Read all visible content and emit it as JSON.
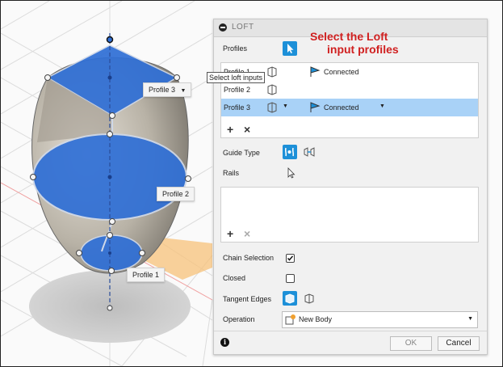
{
  "panel": {
    "title": "LOFT",
    "profiles_label": "Profiles",
    "profile_rows": [
      {
        "name": "Profile 1",
        "connection": "Connected",
        "selected": false
      },
      {
        "name": "Profile 2",
        "connection": "",
        "selected": false
      },
      {
        "name": "Profile 3",
        "connection": "Connected",
        "selected": true
      }
    ],
    "tooltip": "Select loft inputs",
    "guide_type_label": "Guide Type",
    "rails_label": "Rails",
    "chain_selection_label": "Chain Selection",
    "chain_selection_checked": true,
    "closed_label": "Closed",
    "closed_checked": false,
    "tangent_edges_label": "Tangent Edges",
    "operation_label": "Operation",
    "operation_value": "New Body",
    "ok_label": "OK",
    "cancel_label": "Cancel",
    "add_symbol": "+",
    "remove_symbol": "×"
  },
  "annotation": {
    "line1": "Select the Loft",
    "line2": "input profiles"
  },
  "viewport": {
    "labels": {
      "profile_3": "Profile 3",
      "profile_2": "Profile 2",
      "profile_1": "Profile 1"
    }
  },
  "colors": {
    "accent": "#1d90d8",
    "selection_row": "#a9d2f7",
    "profile_fill": "#2f6fd6",
    "annotation_red": "#d02020"
  },
  "icons": {
    "collapse": "minus-circle-icon",
    "select": "cursor-arrow-icon",
    "profile": "sketch-profile-icon",
    "connected": "connected-flag-icon",
    "guide_rails": "rail-guide-icon",
    "guide_centerline": "centerline-guide-icon",
    "rails_select": "cursor-arrow-icon",
    "tangent_edges_merge": "merge-edges-icon",
    "tangent_edges_keep": "keep-edges-icon",
    "new_body": "new-body-icon",
    "info": "info-icon"
  }
}
